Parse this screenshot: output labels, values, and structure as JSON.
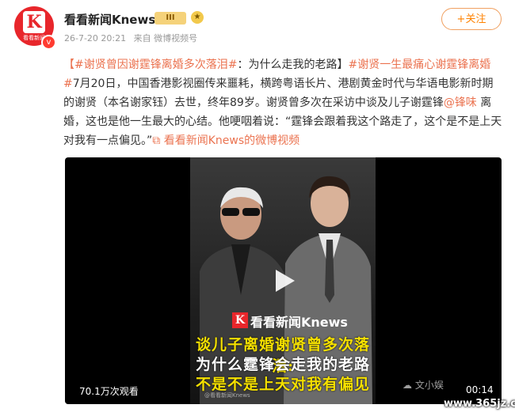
{
  "header": {
    "avatar_text": "看看新闻",
    "avatar_letter": "K",
    "verify_mark": "v",
    "account_name": "看看新闻Knews",
    "vip_label": "III",
    "timestamp": "26-7-20 20:21",
    "source": "来自 微博视频号",
    "follow_label": "+关注"
  },
  "post": {
    "tag1": "【#谢贤曾因谢霆锋离婚多次落泪#",
    "tag1_tail": "：为什么走我的老路】",
    "tag2": "#谢贤一生最痛心谢霆锋离婚#",
    "body1": "7月20日，中国香港影视圈传来噩耗，横跨粤语长片、港剧黄金时代与华语电影新时期的谢贤（本名谢家钰）去世，终年89岁。谢贤曾多次在采访中谈及儿子谢霆锋",
    "mention": "@锋味",
    "body2": " 离婚，这也是他一生最大的心结。他哽咽着说：“霆锋会跟着我这个路走了，这个是不是上天对我有一点偏见。”",
    "video_link": "看看新闻Knews的微博视频"
  },
  "video": {
    "overlay_brand": "看看新闻Knews",
    "caption1": "谈儿子离婚谢贤曾多次落泪:",
    "caption2": "为什么霆锋会走我的老路",
    "caption3": "不是不是上天对我有偏见",
    "view_count": "70.1万次观看",
    "small_watermark": "@看看新闻Knews",
    "duration": "00:14"
  },
  "watermark": {
    "author": "文小娱",
    "url": "www.365jz.com"
  },
  "colors": {
    "link": "#eb7350",
    "follow": "#ff8200",
    "caption_yellow": "#f5e000"
  }
}
